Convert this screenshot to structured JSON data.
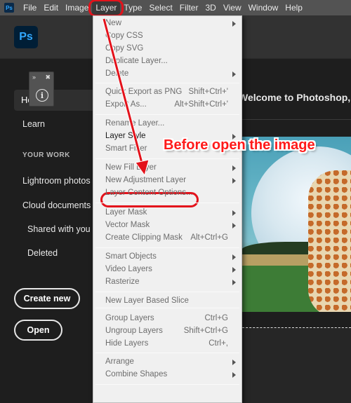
{
  "menubar": {
    "app_icon": "Ps",
    "items": [
      "File",
      "Edit",
      "Image",
      "Layer",
      "Type",
      "Select",
      "Filter",
      "3D",
      "View",
      "Window",
      "Help"
    ],
    "active": "Layer"
  },
  "header": {
    "logo": "Ps"
  },
  "mini_panel": {
    "expand": "»",
    "close": "✖",
    "info": "i"
  },
  "sidebar": {
    "home": "Home",
    "learn": "Learn",
    "section": "YOUR WORK",
    "items": [
      "Lightroom photos",
      "Cloud documents",
      "Shared with you",
      "Deleted"
    ],
    "create_new": "Create new",
    "open": "Open"
  },
  "main": {
    "welcome": "Welcome to Photoshop, Sha"
  },
  "layer_menu": {
    "items": [
      {
        "label": "New",
        "shortcut": "",
        "submenu": true,
        "enabled": false
      },
      {
        "label": "Copy CSS",
        "shortcut": "",
        "submenu": false,
        "enabled": false
      },
      {
        "label": "Copy SVG",
        "shortcut": "",
        "submenu": false,
        "enabled": false
      },
      {
        "label": "Duplicate Layer...",
        "shortcut": "",
        "submenu": false,
        "enabled": false
      },
      {
        "label": "Delete",
        "shortcut": "",
        "submenu": true,
        "enabled": false
      },
      {
        "label": "Quick Export as PNG",
        "shortcut": "Shift+Ctrl+'",
        "submenu": false,
        "enabled": false
      },
      {
        "label": "Export As...",
        "shortcut": "Alt+Shift+Ctrl+'",
        "submenu": false,
        "enabled": false
      },
      {
        "label": "Rename Layer...",
        "shortcut": "",
        "submenu": false,
        "enabled": false
      },
      {
        "label": "Layer Style",
        "shortcut": "",
        "submenu": true,
        "enabled": true
      },
      {
        "label": "Smart Filter",
        "shortcut": "",
        "submenu": false,
        "enabled": false
      },
      {
        "label": "New Fill Layer",
        "shortcut": "",
        "submenu": true,
        "enabled": false
      },
      {
        "label": "New Adjustment Layer",
        "shortcut": "",
        "submenu": true,
        "enabled": false
      },
      {
        "label": "Layer Content Options...",
        "shortcut": "",
        "submenu": false,
        "enabled": false
      },
      {
        "label": "Layer Mask",
        "shortcut": "",
        "submenu": true,
        "enabled": false
      },
      {
        "label": "Vector Mask",
        "shortcut": "",
        "submenu": true,
        "enabled": false
      },
      {
        "label": "Create Clipping Mask",
        "shortcut": "Alt+Ctrl+G",
        "submenu": false,
        "enabled": false
      },
      {
        "label": "Smart Objects",
        "shortcut": "",
        "submenu": true,
        "enabled": false
      },
      {
        "label": "Video Layers",
        "shortcut": "",
        "submenu": true,
        "enabled": false
      },
      {
        "label": "Rasterize",
        "shortcut": "",
        "submenu": true,
        "enabled": false
      },
      {
        "label": "New Layer Based Slice",
        "shortcut": "",
        "submenu": false,
        "enabled": false
      },
      {
        "label": "Group Layers",
        "shortcut": "Ctrl+G",
        "submenu": false,
        "enabled": false
      },
      {
        "label": "Ungroup Layers",
        "shortcut": "Shift+Ctrl+G",
        "submenu": false,
        "enabled": false
      },
      {
        "label": "Hide Layers",
        "shortcut": "Ctrl+,",
        "submenu": false,
        "enabled": false
      },
      {
        "label": "Arrange",
        "shortcut": "",
        "submenu": true,
        "enabled": false
      },
      {
        "label": "Combine Shapes",
        "shortcut": "",
        "submenu": true,
        "enabled": false
      }
    ]
  },
  "annotation": {
    "text": "Before open the image",
    "color": "#ff1a1a"
  },
  "colors": {
    "highlight": "#e3121b",
    "ps_blue": "#31a8ff",
    "ps_dark": "#001e36"
  }
}
